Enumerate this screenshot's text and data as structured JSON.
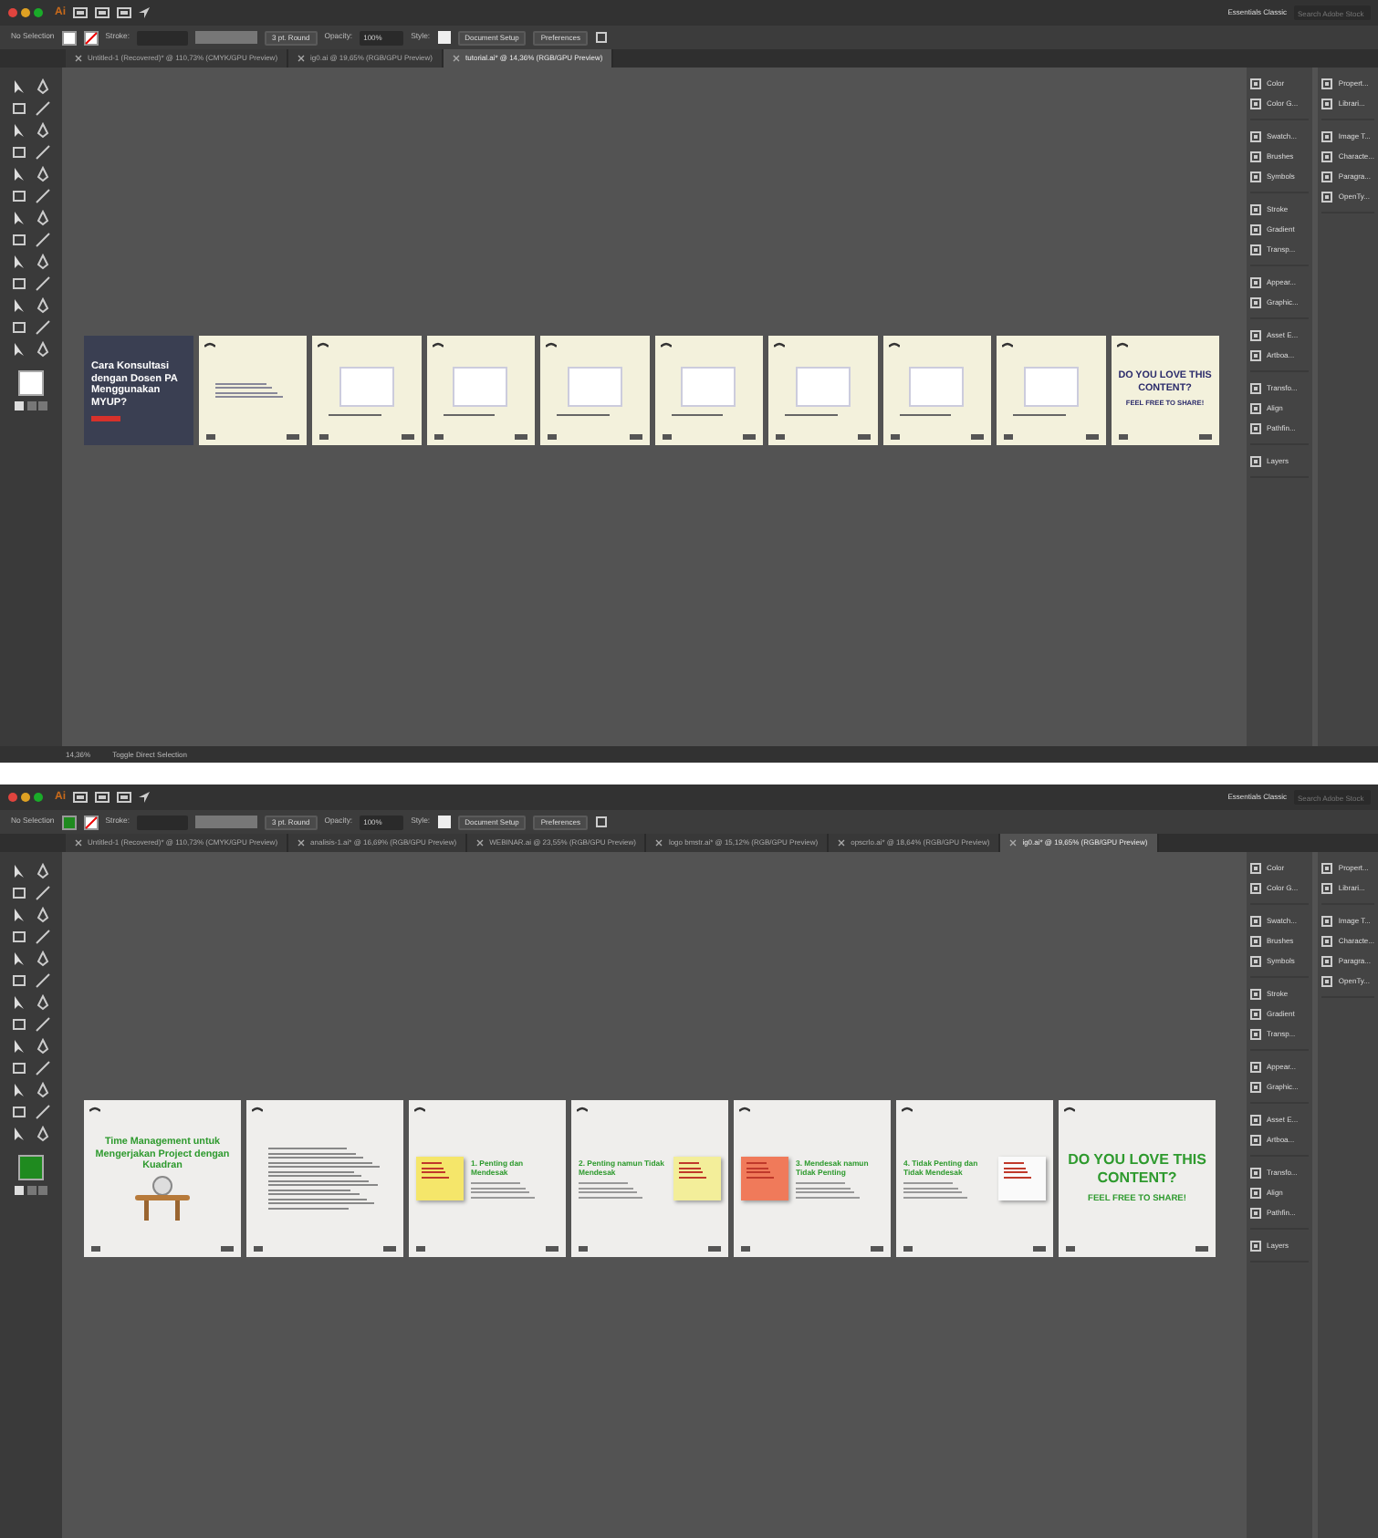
{
  "screens": [
    {
      "app_bar": {
        "logo": "Ai",
        "workspace": "Essentials Classic",
        "search_placeholder": "Search Adobe Stock"
      },
      "control_bar": {
        "selection": "No Selection",
        "fill": {
          "color": "#ffffff"
        },
        "stroke_label": "Stroke:",
        "brush": "3 pt. Round",
        "opacity_label": "Opacity:",
        "opacity": "100%",
        "style_label": "Style:",
        "buttons": [
          "Document Setup",
          "Preferences"
        ]
      },
      "tabs": [
        {
          "label": "Untitled-1 (Recovered)* @ 110,73% (CMYK/GPU Preview)",
          "selected": false
        },
        {
          "label": "ig0.ai @ 19,65% (RGB/GPU Preview)",
          "selected": false
        },
        {
          "label": "tutorial.ai* @ 14,36% (RGB/GPU Preview)",
          "selected": true
        }
      ],
      "artboards": [
        {
          "kind": "cover",
          "color": "#3a3f52",
          "title": {
            "text": "Cara Konsultasi dengan Dosen PA Menggunakan MYUP?",
            "color": "#ffffff"
          }
        },
        {
          "kind": "text",
          "color": "#f3f1dc"
        },
        {
          "kind": "screenshot",
          "color": "#f3f1dc"
        },
        {
          "kind": "screenshot",
          "color": "#f3f1dc"
        },
        {
          "kind": "screenshot",
          "color": "#f3f1dc"
        },
        {
          "kind": "screenshot",
          "color": "#f3f1dc"
        },
        {
          "kind": "screenshot",
          "color": "#f3f1dc"
        },
        {
          "kind": "screenshot",
          "color": "#f3f1dc"
        },
        {
          "kind": "screenshot",
          "color": "#f3f1dc"
        },
        {
          "kind": "closing",
          "color": "#f3f1dc",
          "title": {
            "text": "DO YOU LOVE THIS CONTENT?",
            "color": "#2b2b6b"
          },
          "subtitle": "FEEL FREE TO SHARE!"
        }
      ],
      "panels": {
        "left": [
          [
            "Color",
            "Color G..."
          ],
          [
            "Swatch...",
            "Brushes",
            "Symbols"
          ],
          [
            "Stroke",
            "Gradient",
            "Transp..."
          ],
          [
            "Appear...",
            "Graphic..."
          ],
          [
            "Asset E...",
            "Artboa..."
          ],
          [
            "Transfo...",
            "Align",
            "Pathfin..."
          ],
          [
            "Layers"
          ]
        ],
        "right": [
          [
            "Propert...",
            "Librari..."
          ],
          [
            "Image T...",
            "Characte...",
            "Paragra...",
            "OpenTy..."
          ]
        ]
      },
      "status_bar": {
        "zoom": "14,36%",
        "tool": "Toggle Direct Selection"
      }
    },
    {
      "app_bar": {
        "logo": "Ai",
        "workspace": "Essentials Classic",
        "search_placeholder": "Search Adobe Stock"
      },
      "control_bar": {
        "selection": "No Selection",
        "fill": {
          "color": "#1f8a1f"
        },
        "stroke_label": "Stroke:",
        "brush": "3 pt. Round",
        "opacity_label": "Opacity:",
        "opacity": "100%",
        "style_label": "Style:",
        "buttons": [
          "Document Setup",
          "Preferences"
        ]
      },
      "tabs": [
        {
          "label": "Untitled-1 (Recovered)* @ 110,73% (CMYK/GPU Preview)",
          "selected": false
        },
        {
          "label": "analisis-1.ai* @ 16,69% (RGB/GPU Preview)",
          "selected": false
        },
        {
          "label": "WEBINAR.ai @ 23,55% (RGB/GPU Preview)",
          "selected": false
        },
        {
          "label": "logo bmstr.ai* @ 15,12% (RGB/GPU Preview)",
          "selected": false
        },
        {
          "label": "opscrlo.ai* @ 18,64% (RGB/GPU Preview)",
          "selected": false
        },
        {
          "label": "ig0.ai* @ 19,65% (RGB/GPU Preview)",
          "selected": true
        }
      ],
      "artboards": [
        {
          "kind": "title",
          "color": "#efeeec",
          "title": {
            "text": "Time Management untuk Mengerjakan Project dengan Kuadran",
            "color": "#2e9a2e"
          }
        },
        {
          "kind": "text",
          "color": "#efeeec"
        },
        {
          "kind": "quadrant",
          "color": "#efeeec",
          "title": {
            "text": "1. Penting dan Mendesak",
            "color": "#2e9a2e"
          },
          "note": {
            "color": "#f5e66a"
          }
        },
        {
          "kind": "quadrant",
          "color": "#efeeec",
          "title": {
            "text": "2. Penting namun Tidak Mendesak",
            "color": "#2e9a2e"
          },
          "note": {
            "color": "#f3ee9a"
          }
        },
        {
          "kind": "quadrant",
          "color": "#efeeec",
          "title": {
            "text": "3. Mendesak namun Tidak Penting",
            "color": "#2e9a2e"
          },
          "note": {
            "color": "#f07a5a"
          }
        },
        {
          "kind": "quadrant",
          "color": "#efeeec",
          "title": {
            "text": "4. Tidak Penting dan Tidak Mendesak",
            "color": "#2e9a2e"
          },
          "note": {
            "color": "#fafafa"
          }
        },
        {
          "kind": "closing",
          "color": "#efeeec",
          "title": {
            "text": "DO YOU LOVE THIS CONTENT?",
            "color": "#2e9a2e"
          },
          "subtitle": "FEEL FREE TO SHARE!"
        }
      ],
      "panels": {
        "left": [
          [
            "Color",
            "Color G..."
          ],
          [
            "Swatch...",
            "Brushes",
            "Symbols"
          ],
          [
            "Stroke",
            "Gradient",
            "Transp..."
          ],
          [
            "Appear...",
            "Graphic..."
          ],
          [
            "Asset E...",
            "Artboa..."
          ],
          [
            "Transfo...",
            "Align",
            "Pathfin..."
          ],
          [
            "Layers"
          ]
        ],
        "right": [
          [
            "Propert...",
            "Librari..."
          ],
          [
            "Image T...",
            "Characte...",
            "Paragra...",
            "OpenTy..."
          ]
        ]
      }
    }
  ]
}
